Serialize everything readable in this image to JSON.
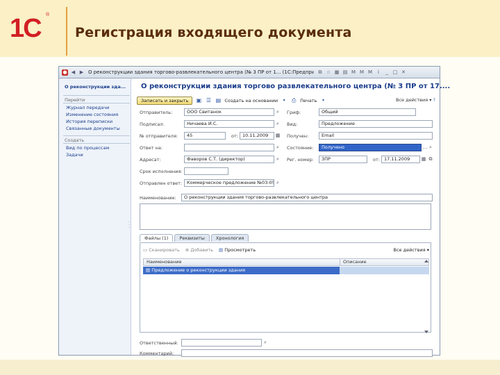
{
  "slide": {
    "logo_text": "1С",
    "logo_reg": "®",
    "title": "Регистрация входящего документа"
  },
  "window": {
    "title": "О реконструкции здания торгово-развлекательного центра (№ 3 ПР от 1... (1С:Предприятие)",
    "icon_color": "#c8312a"
  },
  "nav": {
    "doc_title": "О реконструкции зда...",
    "section_goto": "Перейти",
    "goto_items": [
      "Журнал передачи",
      "Изменение состояния",
      "История переписки",
      "Связанные документы"
    ],
    "section_create": "Создать",
    "create_items": [
      "Вид по процессам",
      "Задачи"
    ]
  },
  "form": {
    "title": "О реконструкции здания торгово развлекательного центра (№ 3 ПР от 17....",
    "toolbar": {
      "save_close": "Записать и закрыть",
      "create_basis": "Создать на основании",
      "print": "Печать",
      "all_actions": "Все действия"
    },
    "fields": {
      "sender_label": "Отправитель:",
      "sender_value": "ООО Свитанок",
      "signer_label": "Подписал:",
      "signer_value": "Ничаева И.С.",
      "outgoing_no_label": "№ отправителя:",
      "outgoing_no_value": "45",
      "date_from_label": "от:",
      "date_from_value": "10.11.2009",
      "reply_to_label": "Ответ на:",
      "reply_to_value": "",
      "addressee_label": "Адресат:",
      "addressee_value": "Фаворов С.Т. (директор)",
      "reply_deadline_label": "Срок исполнения:",
      "reply_deadline_value": "",
      "sent_label": "Отправлен ответ:",
      "sent_value": "Коммерческое предложение №03-05-",
      "name_label": "Наименование:",
      "name_value": "О реконструкции здания торгово-развлекательного центра",
      "stamp_label": "Гриф:",
      "stamp_value": "Общий",
      "type_label": "Вид:",
      "type_value": "Предложение",
      "delivery_label": "Получен:",
      "delivery_value": "Email",
      "state_label": "Состояние:",
      "state_value": "Получено",
      "reg_no_label": "Рег. номер:",
      "reg_no_value": "3ПР",
      "reg_date_label": "от:",
      "reg_date_value": "17.11.2009",
      "responsible_label": "Ответственный:",
      "responsible_value": "",
      "comment_label": "Комментарий:",
      "comment_value": ""
    },
    "tabs": [
      {
        "label": "Файлы (1)",
        "active": true
      },
      {
        "label": "Реквизиты",
        "active": false
      },
      {
        "label": "Хронология",
        "active": false
      }
    ],
    "files": {
      "tool_scan": "Сканировать",
      "tool_add": "Добавить",
      "tool_open": "Просмотреть",
      "tool_more": "Все действия",
      "col_name": "Наименование",
      "col_size": "Описание",
      "rows": [
        {
          "name": "Предложение о реконструкции здания",
          "size": ""
        }
      ]
    }
  }
}
